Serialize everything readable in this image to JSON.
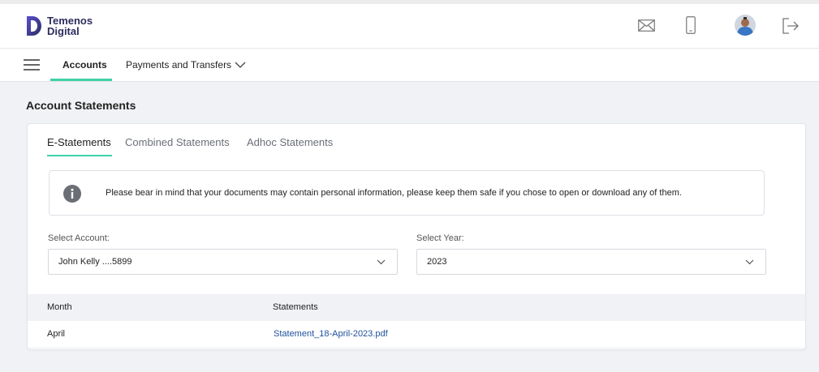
{
  "header": {
    "logo_line1": "Temenos",
    "logo_line2": "Digital",
    "icons": [
      "mail-icon",
      "mobile-icon",
      "avatar",
      "logout-icon"
    ]
  },
  "nav": {
    "menu_icon": "hamburger-icon",
    "items": [
      {
        "label": "Accounts",
        "active": true
      },
      {
        "label": "Payments and Transfers",
        "active": false
      }
    ]
  },
  "page": {
    "title": "Account Statements"
  },
  "tabs": [
    {
      "label": "E-Statements",
      "active": true
    },
    {
      "label": "Combined Statements",
      "active": false
    },
    {
      "label": "Adhoc Statements",
      "active": false
    }
  ],
  "info": {
    "icon": "info-icon",
    "text": "Please bear in mind that your documents may contain personal information, please keep them safe if you chose to open or download any of them."
  },
  "filters": {
    "account": {
      "label": "Select Account:",
      "value": "John Kelly ....5899"
    },
    "year": {
      "label": "Select Year:",
      "value": "2023"
    }
  },
  "table": {
    "columns": [
      "Month",
      "Statements"
    ],
    "rows": [
      {
        "month": "April",
        "statement": "Statement_18-April-2023.pdf"
      }
    ]
  },
  "colors": {
    "accent": "#3ed2a6",
    "link": "#1f4f9c",
    "brand": "#2c2e5e"
  }
}
